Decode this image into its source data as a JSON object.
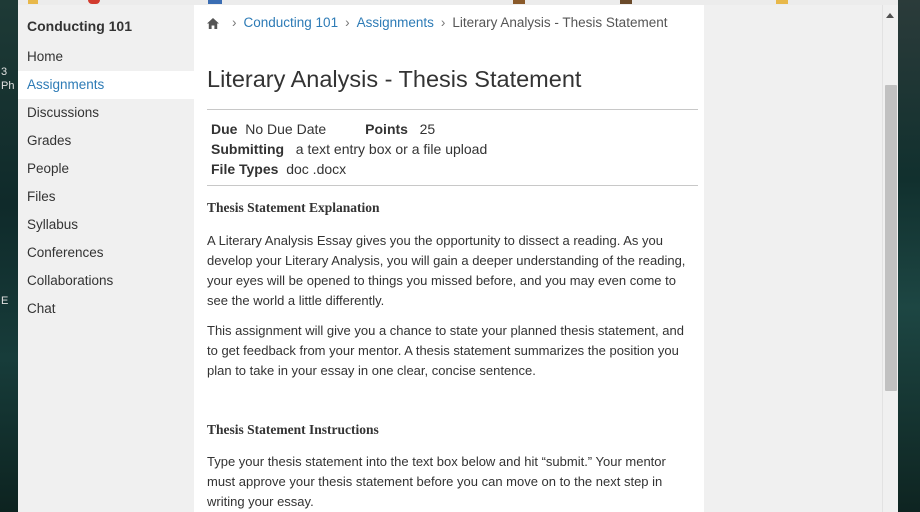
{
  "colors": {
    "link": "#2d7bb6",
    "text": "#333333",
    "sidebar_bg": "#f0f0f0",
    "active_bg": "#ffffff"
  },
  "desktop": {
    "fragments": [
      "3",
      "Ph",
      "E"
    ]
  },
  "sidebar": {
    "course_title": "Conducting 101",
    "items": [
      {
        "label": "Home",
        "active": false
      },
      {
        "label": "Assignments",
        "active": true
      },
      {
        "label": "Discussions",
        "active": false
      },
      {
        "label": "Grades",
        "active": false
      },
      {
        "label": "People",
        "active": false
      },
      {
        "label": "Files",
        "active": false
      },
      {
        "label": "Syllabus",
        "active": false
      },
      {
        "label": "Conferences",
        "active": false
      },
      {
        "label": "Collaborations",
        "active": false
      },
      {
        "label": "Chat",
        "active": false
      }
    ]
  },
  "breadcrumb": {
    "home_icon": "home-icon",
    "course": "Conducting 101",
    "section": "Assignments",
    "current": "Literary Analysis - Thesis Statement"
  },
  "assignment": {
    "title": "Literary Analysis - Thesis Statement",
    "due_label": "Due",
    "due_value": "No Due Date",
    "points_label": "Points",
    "points_value": "25",
    "submitting_label": "Submitting",
    "submitting_value": "a text entry box or a file upload",
    "file_types_label": "File Types",
    "file_types_value": "doc .docx"
  },
  "content": {
    "heading1": "Thesis Statement Explanation",
    "para1_lines": [
      "A Literary Analysis Essay gives you the opportunity to dissect a reading. As you",
      "develop your Literary Analysis, you will gain a deeper understanding of the reading,",
      "your eyes will be opened to things you missed before, and you may even come to",
      "see the world a little differently."
    ],
    "para2_lines": [
      "This assignment will give you a chance to state your planned thesis statement, and",
      "to get feedback from your mentor. A thesis statement summarizes the position you",
      "plan to take in your essay in one clear, concise sentence."
    ],
    "heading2": "Thesis Statement Instructions",
    "para3_lines": [
      "Type your thesis statement into the text box below and hit “submit.” Your mentor",
      "must approve your thesis statement before you can move on to the next step in",
      "writing your essay."
    ]
  }
}
